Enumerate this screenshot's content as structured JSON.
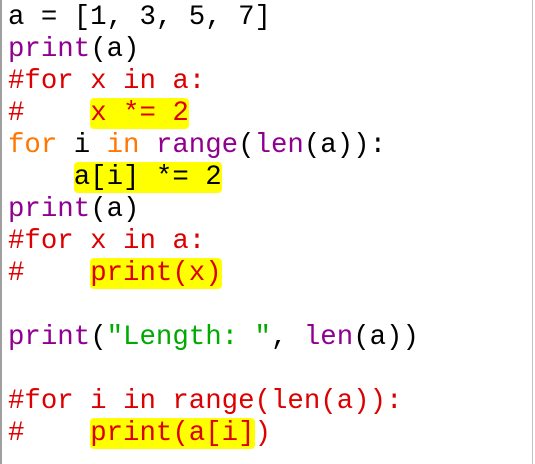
{
  "colors": {
    "keyword": "#ff7700",
    "builtin": "#900090",
    "comment": "#dd0000",
    "string": "#00aa00",
    "default": "#000000",
    "highlight": "#ffff00"
  },
  "lines": [
    [
      {
        "t": "a = [1, 3, 5, 7]",
        "c": "df"
      }
    ],
    [
      {
        "t": "print",
        "c": "bi"
      },
      {
        "t": "(a)",
        "c": "df"
      }
    ],
    [
      {
        "t": "#for x in a:",
        "c": "cm"
      }
    ],
    [
      {
        "t": "#    ",
        "c": "cm"
      },
      {
        "t": "x *= 2",
        "c": "cm",
        "hl": true
      }
    ],
    [
      {
        "t": "for",
        "c": "kw"
      },
      {
        "t": " i ",
        "c": "df"
      },
      {
        "t": "in",
        "c": "kw"
      },
      {
        "t": " ",
        "c": "df"
      },
      {
        "t": "range",
        "c": "bi"
      },
      {
        "t": "(",
        "c": "df"
      },
      {
        "t": "len",
        "c": "bi"
      },
      {
        "t": "(a)):",
        "c": "df"
      }
    ],
    [
      {
        "t": "    ",
        "c": "df"
      },
      {
        "t": "a[i] *= 2",
        "c": "df",
        "hl": true
      }
    ],
    [
      {
        "t": "print",
        "c": "bi"
      },
      {
        "t": "(a)",
        "c": "df"
      }
    ],
    [
      {
        "t": "#for x in a:",
        "c": "cm"
      }
    ],
    [
      {
        "t": "#    ",
        "c": "cm"
      },
      {
        "t": "print(x)",
        "c": "cm",
        "hl": true
      }
    ],
    [],
    [
      {
        "t": "print",
        "c": "bi"
      },
      {
        "t": "(",
        "c": "df"
      },
      {
        "t": "\"Length: \"",
        "c": "st"
      },
      {
        "t": ", ",
        "c": "df"
      },
      {
        "t": "len",
        "c": "bi"
      },
      {
        "t": "(a))",
        "c": "df"
      }
    ],
    [],
    [
      {
        "t": "#for i in range(len(a)):",
        "c": "cm"
      }
    ],
    [
      {
        "t": "#    ",
        "c": "cm"
      },
      {
        "t": "print(a[i]",
        "c": "cm",
        "hl": true
      },
      {
        "t": ")",
        "c": "cm"
      }
    ]
  ]
}
